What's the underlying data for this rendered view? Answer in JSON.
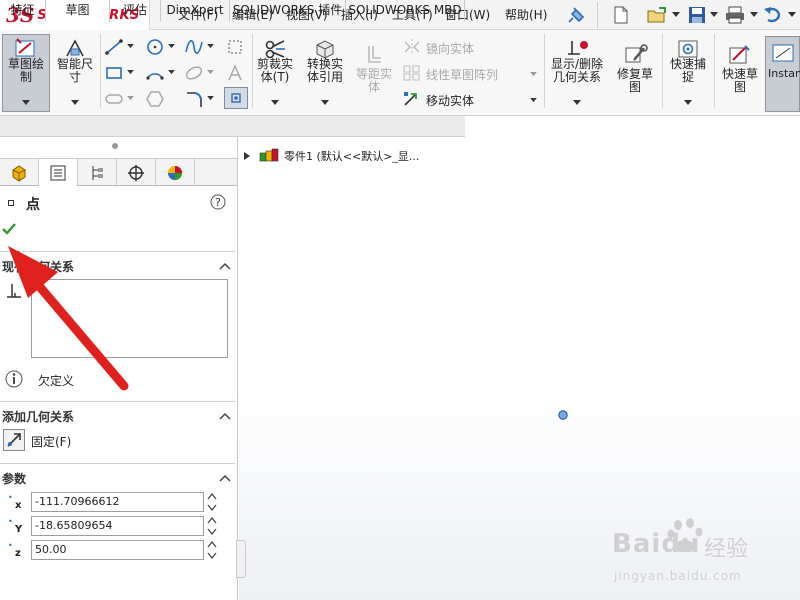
{
  "app": {
    "brand_mark": "3S",
    "brand_name": "SOLIDWORKS"
  },
  "menu": [
    "文件(F)",
    "编辑(E)",
    "视图(V)",
    "插入(I)",
    "工具(T)",
    "窗口(W)",
    "帮助(H)"
  ],
  "quick_icons": [
    "pin-icon",
    "new-document-icon",
    "open-icon",
    "save-icon",
    "print-icon",
    "undo-icon"
  ],
  "ribbon": {
    "sketch_label": "草图绘\n制",
    "smart_dim_label": "智能尺\n寸",
    "trim_label": "剪裁实\n体(T)",
    "convert_label": "转换实\n体引用",
    "offset_label": "等距实\n体",
    "mirror_label": "镜向实体",
    "linear_pattern_label": "线性草图阵列",
    "move_label": "移动实体",
    "display_relations_label": "显示/删除\n几何关系",
    "repair_label": "修复草\n图",
    "quick_snap_label": "快速捕\n捉",
    "rapid_sketch_label": "快速草\n图",
    "instant_label": "Instan"
  },
  "tabs": [
    "特征",
    "草图",
    "评估",
    "DimXpert",
    "SOLIDWORKS 插件",
    "SOLIDWORKS MBD"
  ],
  "active_tab": "草图",
  "tree": {
    "item": "零件1  (默认<<默认>_显..."
  },
  "property_manager": {
    "title": "点",
    "existing_relations": {
      "title": "现有几何关系",
      "status": "欠定义"
    },
    "add_relations": {
      "title": "添加几何关系",
      "fixed_label": "固定(F)"
    },
    "parameters": {
      "title": "参数",
      "x_label": "x",
      "y_label": "Y",
      "z_label": "z",
      "x_value": "-111.70966612",
      "y_value": "-18.65809654",
      "z_value": "50.00"
    }
  },
  "watermark": {
    "brand": "Baidu",
    "cn": "经验",
    "url": "jingyan.baidu.com"
  },
  "colors": {
    "brand_red": "#c8102e",
    "check_green": "#2e9a2e",
    "arrow_red": "#e0201d",
    "point_blue": "#5b8fd4"
  }
}
